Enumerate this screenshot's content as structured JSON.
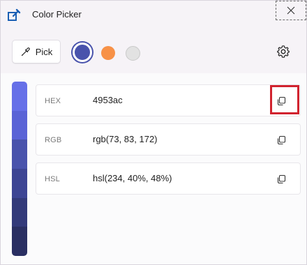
{
  "window": {
    "title": "Color Picker",
    "app_icon": "color-picker-app-icon",
    "close_icon": "close-icon"
  },
  "toolbar": {
    "pick_label": "Pick",
    "pick_icon": "eyedropper-icon",
    "settings_icon": "gear-icon",
    "swatches": [
      {
        "name": "current",
        "color": "#4953ac",
        "selected": true
      },
      {
        "name": "history-1",
        "color": "#f79147",
        "selected": false
      },
      {
        "name": "history-2",
        "color": "#e2e2e2",
        "selected": false
      }
    ]
  },
  "shades": [
    "#6670e8",
    "#5a63d6",
    "#4953ac",
    "#3d4594",
    "#333a7a",
    "#2a2f62"
  ],
  "values": [
    {
      "label": "HEX",
      "value": "4953ac",
      "copy_icon": "copy-icon"
    },
    {
      "label": "RGB",
      "value": "rgb(73, 83, 172)",
      "copy_icon": "copy-icon"
    },
    {
      "label": "HSL",
      "value": "hsl(234, 40%, 48%)",
      "copy_icon": "copy-icon"
    }
  ],
  "colors": {
    "accent": "#4953ac",
    "highlight": "#d1232f"
  }
}
